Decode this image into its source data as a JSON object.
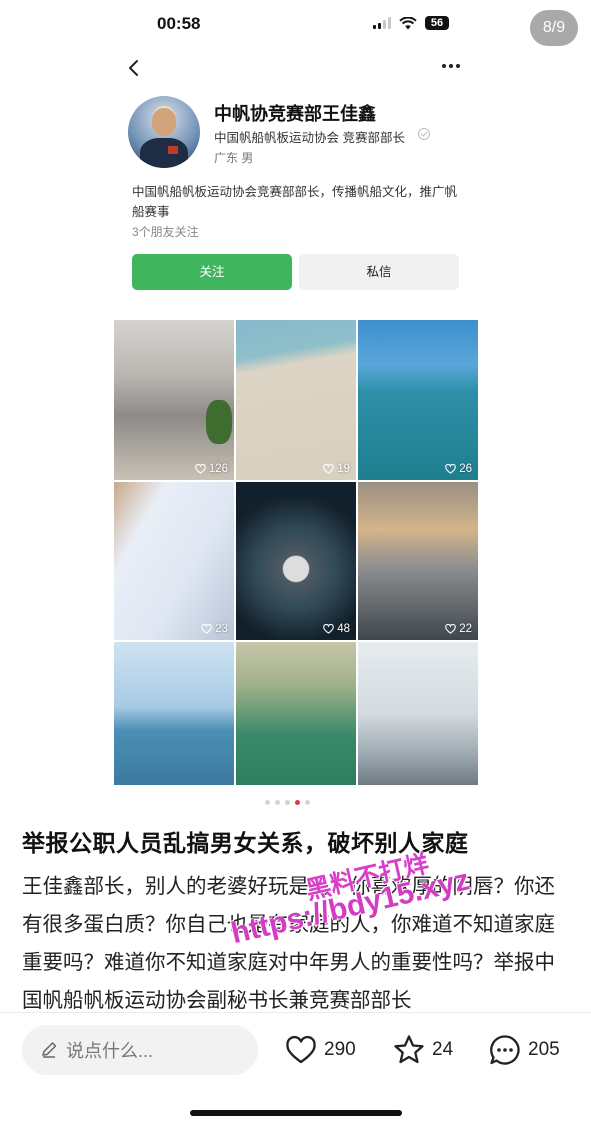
{
  "status_bar": {
    "time": "00:58",
    "battery": "56",
    "page_counter": "8/9"
  },
  "profile": {
    "name": "中帆协竞赛部王佳鑫",
    "organization": "中国帆船帆板运动协会 竞赛部部长",
    "region": "广东 男",
    "bio": "中国帆船帆板运动协会竞赛部部长，传播帆船文化，推广帆船赛事",
    "friends_following": "3个朋友关注",
    "follow_label": "关注",
    "message_label": "私信",
    "icons": {
      "back": "back-arrow-icon",
      "more": "more-icon",
      "verified": "verified-icon"
    }
  },
  "photos": [
    {
      "likes": "126"
    },
    {
      "likes": "19"
    },
    {
      "likes": "26"
    },
    {
      "likes": "23"
    },
    {
      "likes": "48"
    },
    {
      "likes": "22"
    },
    {
      "likes": ""
    },
    {
      "likes": ""
    },
    {
      "likes": ""
    }
  ],
  "pager": {
    "count": 5,
    "active_index": 3
  },
  "post": {
    "title": "举报公职人员乱搞男女关系，破坏别人家庭",
    "body": "王佳鑫部长，别人的老婆好玩是吗？你喜欢厚的阴唇？你还有很多蛋白质？你自己也是有家庭的人，你难道不知道家庭重要吗？难道你不知道家庭对中年男人的重要性吗？举报中国帆船帆板运动协会副秘书长兼竞赛部部长"
  },
  "watermark": {
    "line1": "黑料不打烊",
    "line2": "https://bdy15.xyz"
  },
  "bottom_bar": {
    "comment_placeholder": "说点什么...",
    "likes": "290",
    "stars": "24",
    "comments": "205"
  },
  "colors": {
    "follow_green": "#3fb65d",
    "watermark_magenta": "#d83ec8",
    "active_dot": "#e2374a"
  }
}
